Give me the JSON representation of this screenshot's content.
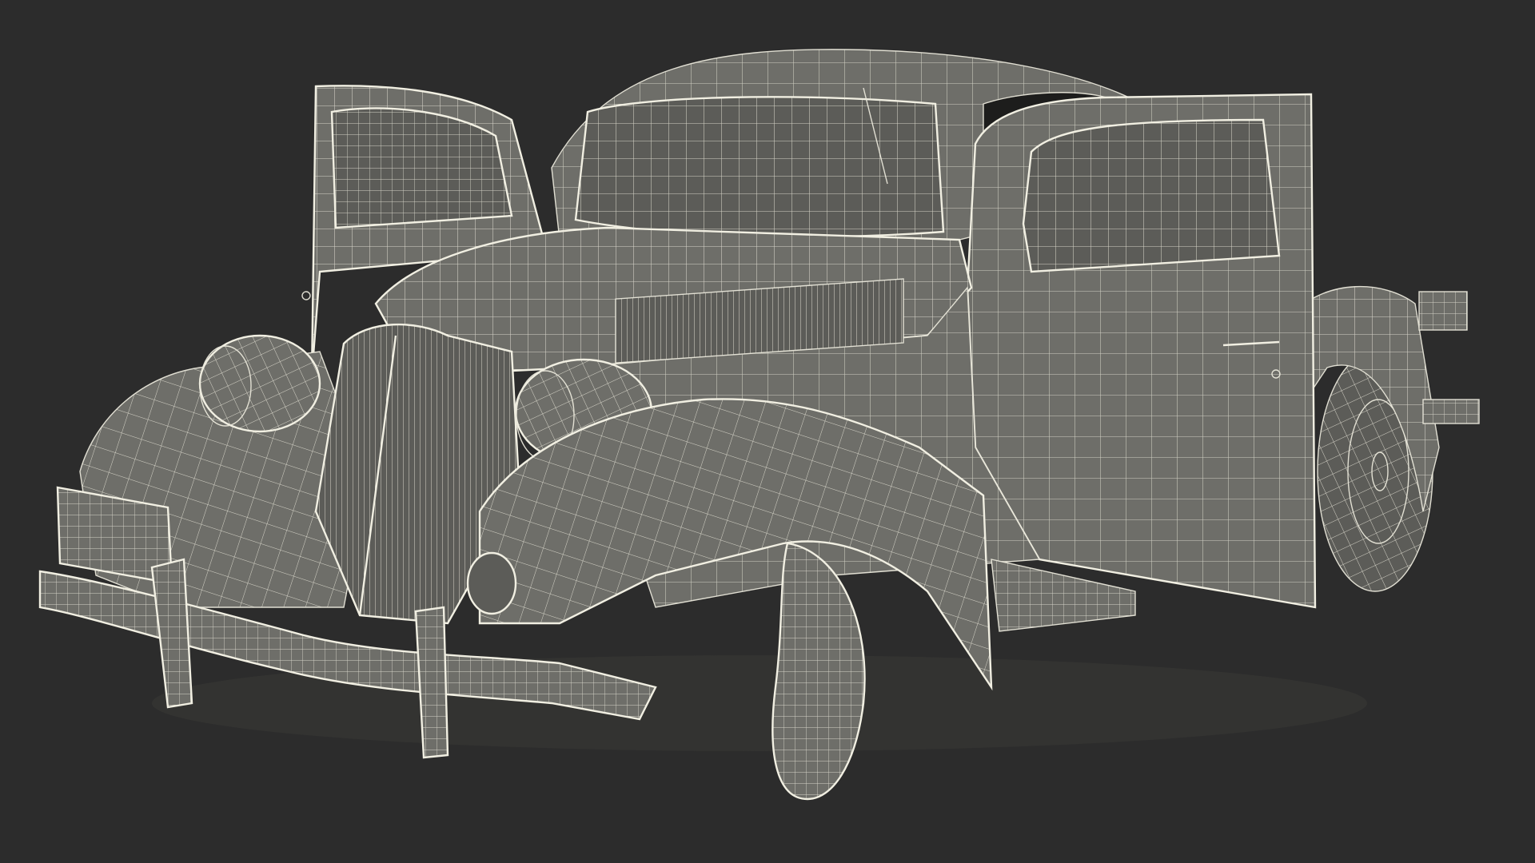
{
  "render": {
    "background": "#2c2c2c",
    "body_fill": "#6e6e69",
    "body_fill_dark": "#5c5c58",
    "wire_color": "#e9e7da",
    "shadow_color": "#3a3a37"
  },
  "subject": {
    "icon": "wireframe-car-model-icon"
  }
}
